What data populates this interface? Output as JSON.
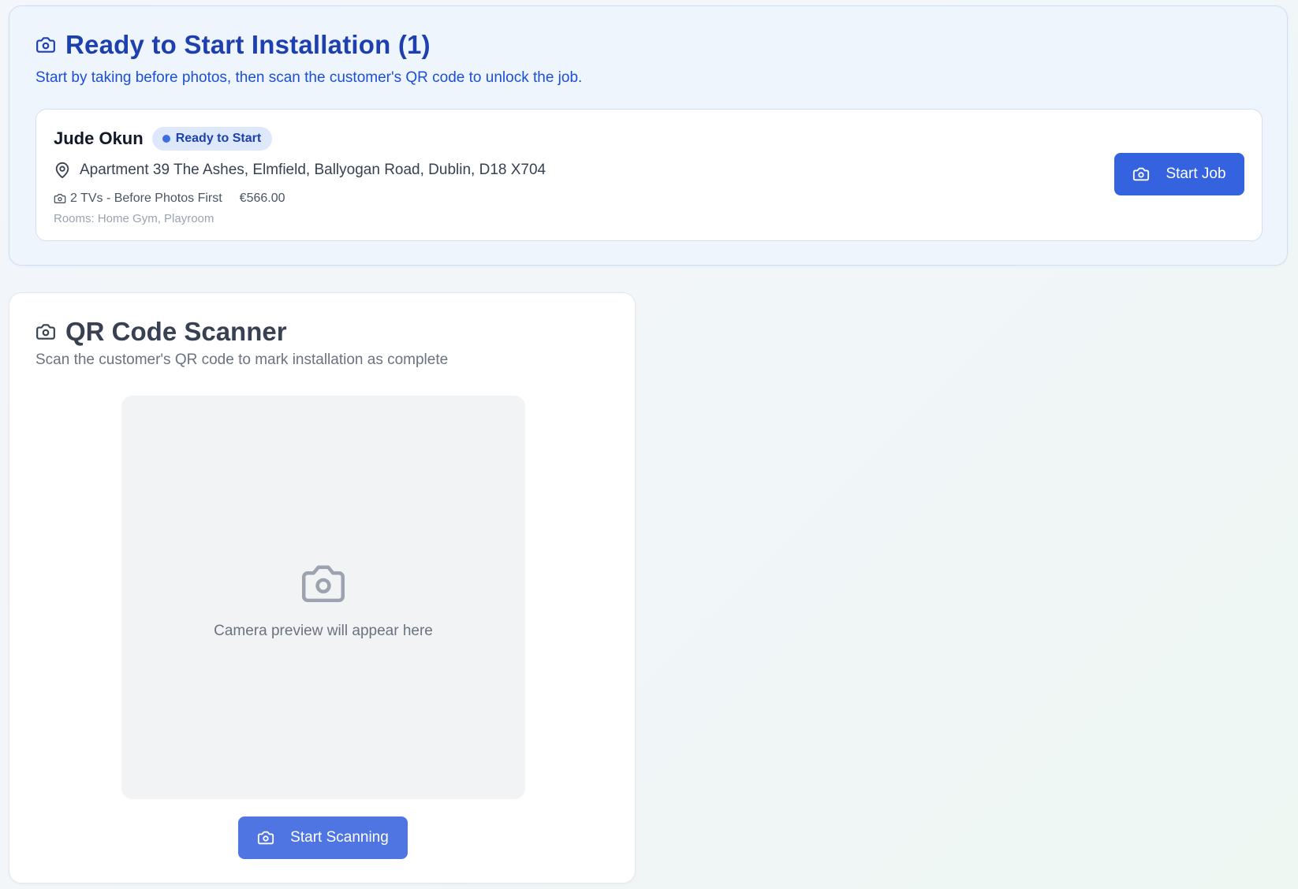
{
  "ready_section": {
    "title": "Ready to Start Installation (1)",
    "subtitle": "Start by taking before photos, then scan the customer's QR code to unlock the job.",
    "icon": "camera-icon",
    "jobs": [
      {
        "customer_name": "Jude Okun",
        "status": "Ready to Start",
        "address": "Apartment 39 The Ashes, Elmfield, Ballyogan Road, Dublin, D18 X704",
        "tv_info": "2 TVs - Before Photos First",
        "price": "€566.00",
        "rooms": "Rooms: Home Gym, Playroom",
        "action_label": "Start Job"
      }
    ]
  },
  "qr_scanner": {
    "title": "QR Code Scanner",
    "subtitle": "Scan the customer's QR code to mark installation as complete",
    "icon": "camera-icon",
    "preview_text": "Camera preview will appear here",
    "button_label": "Start Scanning"
  },
  "colors": {
    "primary_blue": "#3563e0",
    "scan_button_blue": "#4f75e3",
    "heading_blue": "#1e40af",
    "section_bg": "#eef5fd",
    "badge_bg": "#dde9fb"
  }
}
